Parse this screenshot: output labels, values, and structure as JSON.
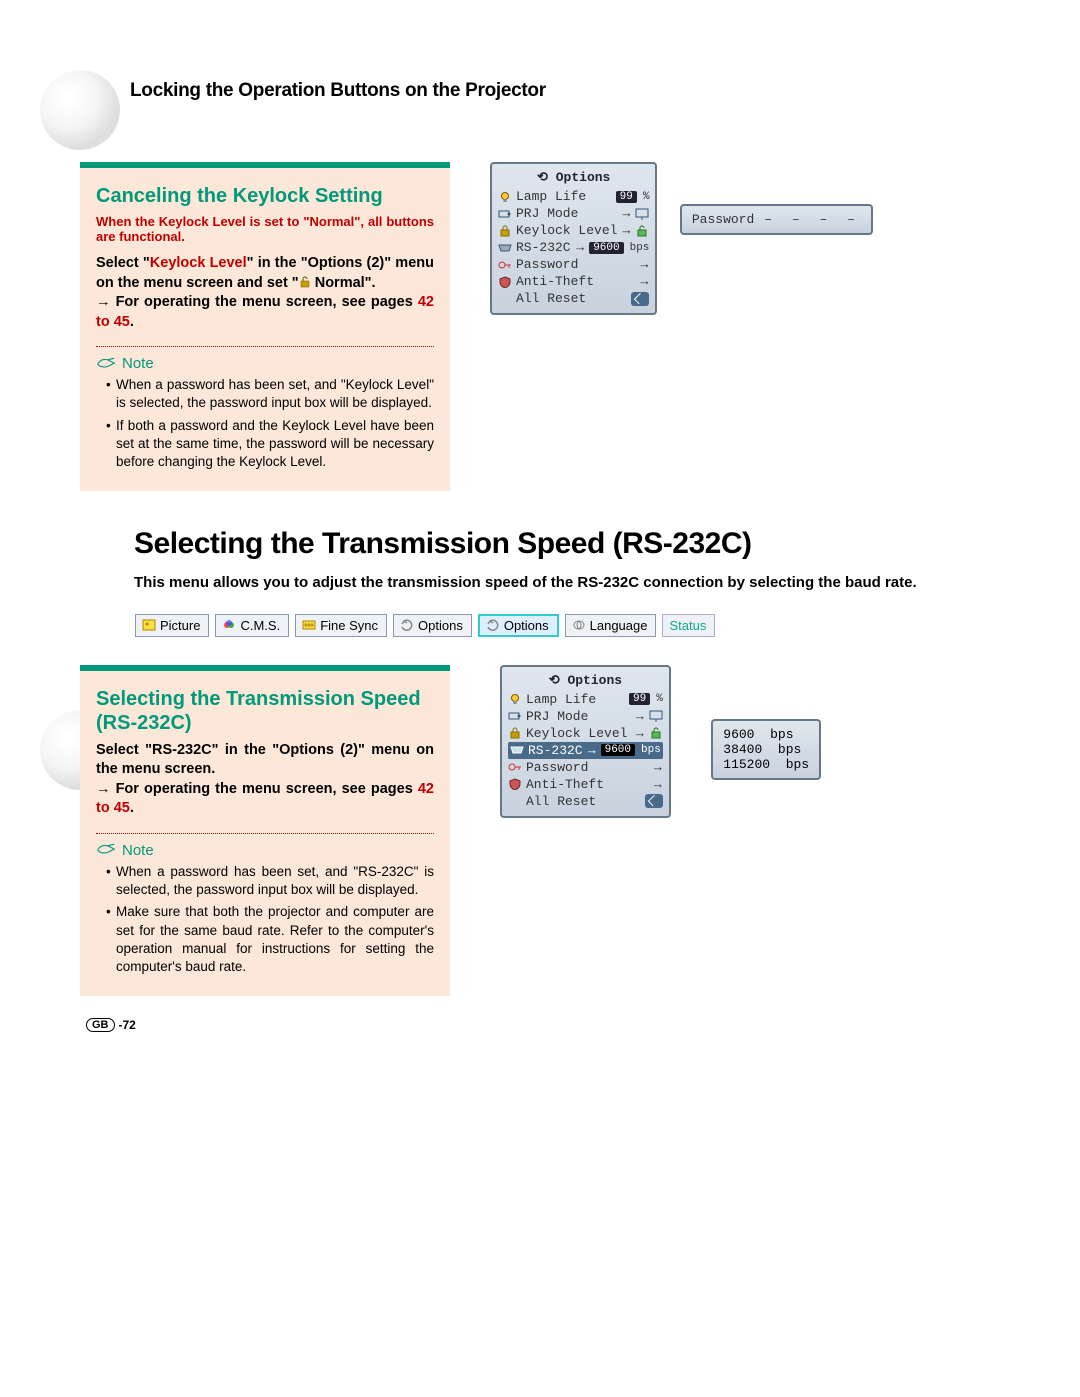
{
  "header": "Locking the Operation Buttons on the Projector",
  "section1": {
    "title": "Canceling the Keylock Setting",
    "intro": "When the Keylock Level is set to \"Normal\", all buttons are functional.",
    "instr_pre": "Select \"",
    "instr_hl": "Keylock Level",
    "instr_post": "\" in the \"Options (2)\" menu on the menu screen and set \"",
    "instr_normal": " Normal\".",
    "instr_arrow": "→ For operating the menu screen, see pages ",
    "pages_link": "42 to 45",
    "note_label": "Note",
    "notes": [
      "When a password has been set, and \"Keylock Level\" is selected, the password input box will be displayed.",
      "If both a password and the Keylock Level have been set at the same time, the password will be necessary before changing the Keylock Level."
    ]
  },
  "osd1": {
    "title": "Options",
    "lamp_life": "Lamp Life",
    "lamp_value": "99",
    "lamp_suffix": "%",
    "prj_mode": "PRJ Mode",
    "keylock": "Keylock Level",
    "rs232c": "RS-232C",
    "rs_value": "9600",
    "rs_suffix": "bps",
    "password": "Password",
    "anti_theft": "Anti-Theft",
    "all_reset": "All Reset"
  },
  "password_panel": {
    "label": "Password",
    "dots": "– – – –"
  },
  "main_h2": "Selecting the Transmission Speed (RS-232C)",
  "main_desc": "This menu allows you to adjust the transmission speed of the RS-232C connection by selecting the baud rate.",
  "tabs": {
    "picture": "Picture",
    "cms": "C.M.S.",
    "finesync": "Fine Sync",
    "options1": "Options",
    "options2": "Options",
    "language": "Language",
    "status": "Status"
  },
  "section2": {
    "title": "Selecting the Transmission Speed (RS-232C)",
    "instr": "Select \"RS-232C\" in the \"Options (2)\" menu on the menu screen.",
    "instr_arrow": "→ For operating the menu screen, see pages ",
    "pages_link": "42 to 45",
    "note_label": "Note",
    "notes": [
      "When a password has been set, and \"RS-232C\" is selected, the password input box will be displayed.",
      "Make sure that both the projector and computer are set for the same baud rate. Refer to the computer's operation manual for instructions for setting the computer's baud rate."
    ]
  },
  "osd2": {
    "title": "Options",
    "lamp_life": "Lamp Life",
    "lamp_value": "99",
    "lamp_suffix": "%",
    "prj_mode": "PRJ Mode",
    "keylock": "Keylock Level",
    "rs232c": "RS-232C",
    "rs_value": "9600",
    "rs_suffix": "bps",
    "password": "Password",
    "anti_theft": "Anti-Theft",
    "all_reset": "All Reset"
  },
  "baud_options": [
    {
      "v": "9600",
      "s": "bps"
    },
    {
      "v": "38400",
      "s": "bps"
    },
    {
      "v": "115200",
      "s": "bps"
    }
  ],
  "page_number": {
    "gb": "GB",
    "num": "-72"
  }
}
